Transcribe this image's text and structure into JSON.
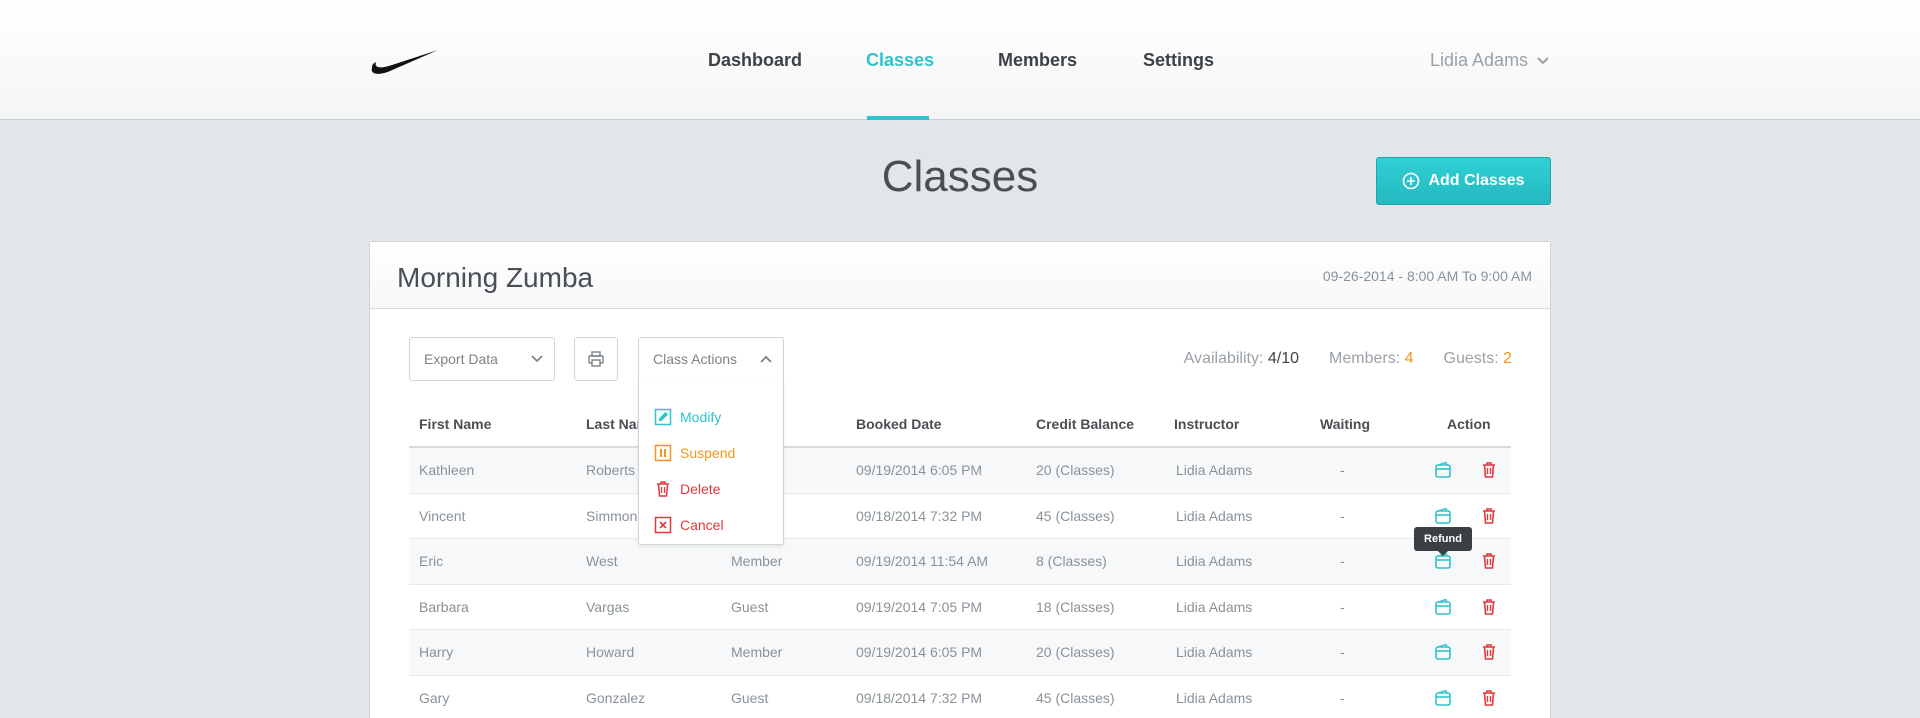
{
  "header": {
    "nav": [
      {
        "label": "Dashboard"
      },
      {
        "label": "Classes"
      },
      {
        "label": "Members"
      },
      {
        "label": "Settings"
      }
    ],
    "active_nav": "Classes",
    "user_name": "Lidia Adams"
  },
  "page": {
    "title": "Classes",
    "add_button": "Add Classes"
  },
  "panel": {
    "title": "Morning Zumba",
    "date": "09-26-2014 - 8:00 AM To 9:00 AM",
    "export_label": "Export Data",
    "class_actions_label": "Class Actions",
    "stats": {
      "availability_label": "Availability:",
      "availability_value": "4/10",
      "members_label": "Members:",
      "members_value": "4",
      "guests_label": "Guests:",
      "guests_value": "2"
    },
    "menu": [
      {
        "label": "Modify"
      },
      {
        "label": "Suspend"
      },
      {
        "label": "Delete"
      },
      {
        "label": "Cancel"
      }
    ],
    "tooltip": "Refund",
    "columns": [
      "First Name",
      "Last Name",
      "Booked Date",
      "Credit Balance",
      "Instructor",
      "Waiting",
      "Action"
    ],
    "rows": [
      {
        "first": "Kathleen",
        "last": "Roberts",
        "type": "",
        "booked": "09/19/2014 6:05 PM",
        "credit": "20 (Classes)",
        "instructor": "Lidia Adams",
        "waiting": "-"
      },
      {
        "first": "Vincent",
        "last": "Simmons",
        "type": "",
        "booked": "09/18/2014 7:32 PM",
        "credit": "45 (Classes)",
        "instructor": "Lidia Adams",
        "waiting": "-"
      },
      {
        "first": "Eric",
        "last": "West",
        "type": "Member",
        "booked": "09/19/2014 11:54 AM",
        "credit": "8 (Classes)",
        "instructor": "Lidia Adams",
        "waiting": "-"
      },
      {
        "first": "Barbara",
        "last": "Vargas",
        "type": "Guest",
        "booked": "09/19/2014 7:05 PM",
        "credit": "18 (Classes)",
        "instructor": "Lidia Adams",
        "waiting": "-"
      },
      {
        "first": "Harry",
        "last": "Howard",
        "type": "Member",
        "booked": "09/19/2014 6:05 PM",
        "credit": "20 (Classes)",
        "instructor": "Lidia Adams",
        "waiting": "-"
      },
      {
        "first": "Gary",
        "last": "Gonzalez",
        "type": "Guest",
        "booked": "09/18/2014 7:32 PM",
        "credit": "45 (Classes)",
        "instructor": "Lidia Adams",
        "waiting": "-"
      }
    ]
  },
  "colors": {
    "accent": "#2ec4cb",
    "warning": "#f2961c",
    "danger": "#e0393e"
  },
  "icons": [
    "swoosh-logo",
    "chevron-down-icon",
    "plus-circle-icon",
    "printer-icon",
    "chevron-up-icon",
    "edit-icon",
    "pause-icon",
    "trash-icon",
    "close-box-icon",
    "wallet-icon"
  ]
}
